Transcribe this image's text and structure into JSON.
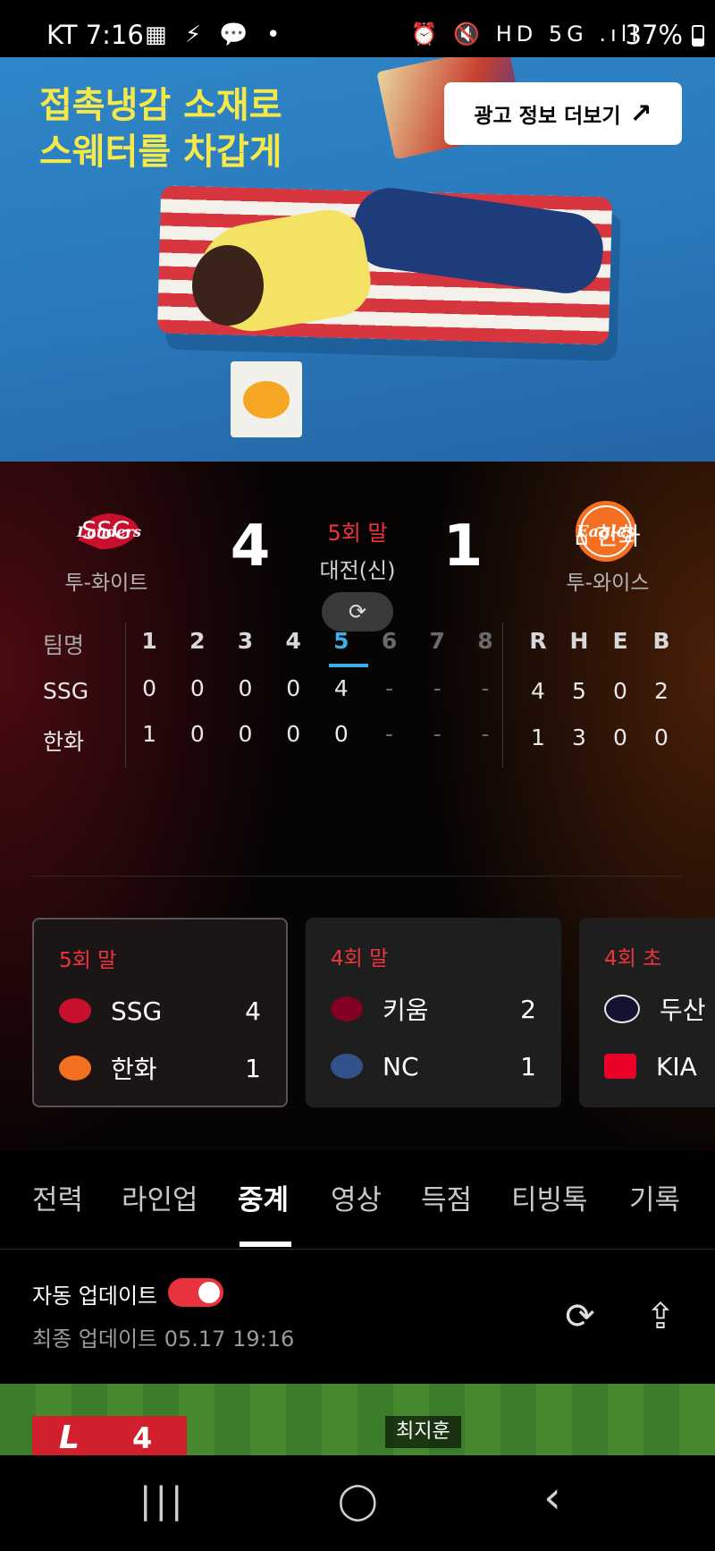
{
  "status_bar": {
    "time": "KT 7:16",
    "left_icons": "▦ ⚡ 💬 •",
    "right_icons": "⏰ 🔇 HD 5G .ıll",
    "battery": "37%"
  },
  "ad": {
    "headline": "접촉냉감 소재로\n스웨터를 차갑게",
    "more_info_button": "광고 정보 더보기",
    "more_info_arrow": "↗"
  },
  "game": {
    "away": {
      "name": "SSG",
      "pitcher": "투-화이트",
      "score": "4",
      "logo_color": "#c8102e"
    },
    "home": {
      "name": "한화",
      "home_icon": "⌂",
      "pitcher": "투-와이스",
      "score": "1",
      "logo_color": "#f36f21"
    },
    "inning": "5회 말",
    "venue": "대전(신)",
    "refresh_icon": "⟳"
  },
  "linescore": {
    "header": {
      "team": "팀명",
      "innings": [
        "1",
        "2",
        "3",
        "4",
        "5",
        "6",
        "7",
        "8"
      ],
      "totals": [
        "R",
        "H",
        "E",
        "B"
      ]
    },
    "current_inning_index": 4,
    "rows": [
      {
        "team": "SSG",
        "innings": [
          "0",
          "0",
          "0",
          "0",
          "4",
          "-",
          "-",
          "-"
        ],
        "totals": [
          "4",
          "5",
          "0",
          "2"
        ]
      },
      {
        "team": "한화",
        "innings": [
          "1",
          "0",
          "0",
          "0",
          "0",
          "-",
          "-",
          "-"
        ],
        "totals": [
          "1",
          "3",
          "0",
          "0"
        ]
      }
    ]
  },
  "other_games": [
    {
      "inning": "5회 말",
      "teams": [
        {
          "name": "SSG",
          "score": "4",
          "color": "#c8102e"
        },
        {
          "name": "한화",
          "score": "1",
          "color": "#f36f21"
        }
      ]
    },
    {
      "inning": "4회 말",
      "teams": [
        {
          "name": "키움",
          "score": "2",
          "color": "#820024"
        },
        {
          "name": "NC",
          "score": "1",
          "color": "#315288"
        }
      ]
    },
    {
      "inning": "4회 초",
      "teams": [
        {
          "name": "두산",
          "score": "",
          "color": "#131230"
        },
        {
          "name": "KIA",
          "score": "",
          "color": "#ea0029"
        }
      ]
    }
  ],
  "tabs": [
    "전력",
    "라인업",
    "중계",
    "영상",
    "득점",
    "티빙톡",
    "기록"
  ],
  "active_tab": "중계",
  "update": {
    "auto_label": "자동 업데이트",
    "auto_enabled": true,
    "last_update": "최종 업데이트 05.17 19:16",
    "refresh_icon": "⟳",
    "share_icon": "⇪"
  },
  "live": {
    "team_logo_letter": "L",
    "score": "4",
    "batter": "최지훈"
  },
  "nav": {
    "recents": "|||",
    "home": "◯",
    "back": "‹"
  }
}
